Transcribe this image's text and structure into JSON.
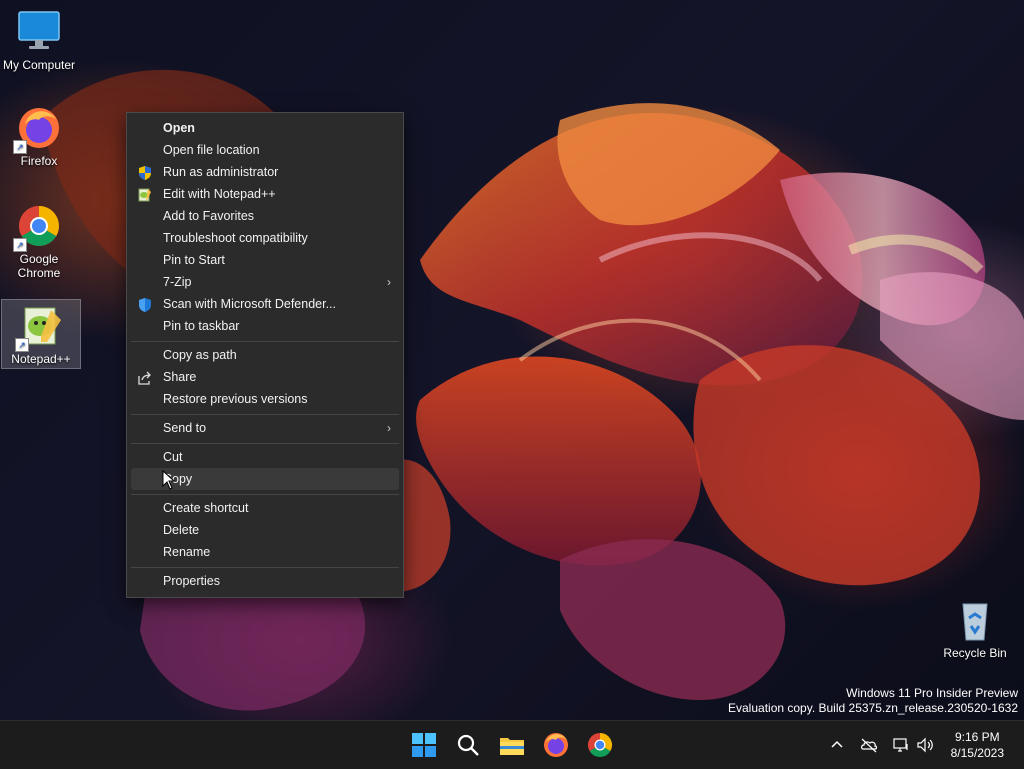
{
  "desktop": {
    "icons": [
      {
        "label": "My Computer",
        "icon": "monitor-icon"
      },
      {
        "label": "Firefox",
        "icon": "firefox-icon"
      },
      {
        "label": "Google Chrome",
        "icon": "chrome-icon"
      },
      {
        "label": "Notepad++",
        "icon": "notepadpp-icon"
      },
      {
        "label": "Recycle Bin",
        "icon": "recycle-bin-icon"
      }
    ]
  },
  "context_menu": {
    "items": [
      {
        "label": "Open"
      },
      {
        "label": "Open file location"
      },
      {
        "label": "Run as administrator",
        "icon": "uac-shield-icon"
      },
      {
        "label": "Edit with Notepad++",
        "icon": "notepadpp-icon"
      },
      {
        "label": "Add to Favorites"
      },
      {
        "label": "Troubleshoot compatibility"
      },
      {
        "label": "Pin to Start"
      },
      {
        "label": "7-Zip",
        "submenu": true
      },
      {
        "label": "Scan with Microsoft Defender...",
        "icon": "defender-shield-icon"
      },
      {
        "label": "Pin to taskbar"
      },
      {
        "label": "Copy as path"
      },
      {
        "label": "Share",
        "icon": "share-icon"
      },
      {
        "label": "Restore previous versions"
      },
      {
        "label": "Send to",
        "submenu": true
      },
      {
        "label": "Cut"
      },
      {
        "label": "Copy",
        "hovered": true
      },
      {
        "label": "Create shortcut"
      },
      {
        "label": "Delete"
      },
      {
        "label": "Rename"
      },
      {
        "label": "Properties"
      }
    ],
    "submenu_arrow": "›"
  },
  "watermark": {
    "line1": "Windows 11 Pro Insider Preview",
    "line2": "Evaluation copy. Build 25375.zn_release.230520-1632"
  },
  "taskbar": {
    "apps": [
      "start-icon",
      "search-icon",
      "file-explorer-icon",
      "firefox-icon",
      "chrome-icon"
    ],
    "tray": [
      "chevron-up-icon",
      "onedrive-icon",
      "network-icon",
      "volume-icon"
    ],
    "clock": {
      "time": "9:16 PM",
      "date": "8/15/2023"
    }
  }
}
